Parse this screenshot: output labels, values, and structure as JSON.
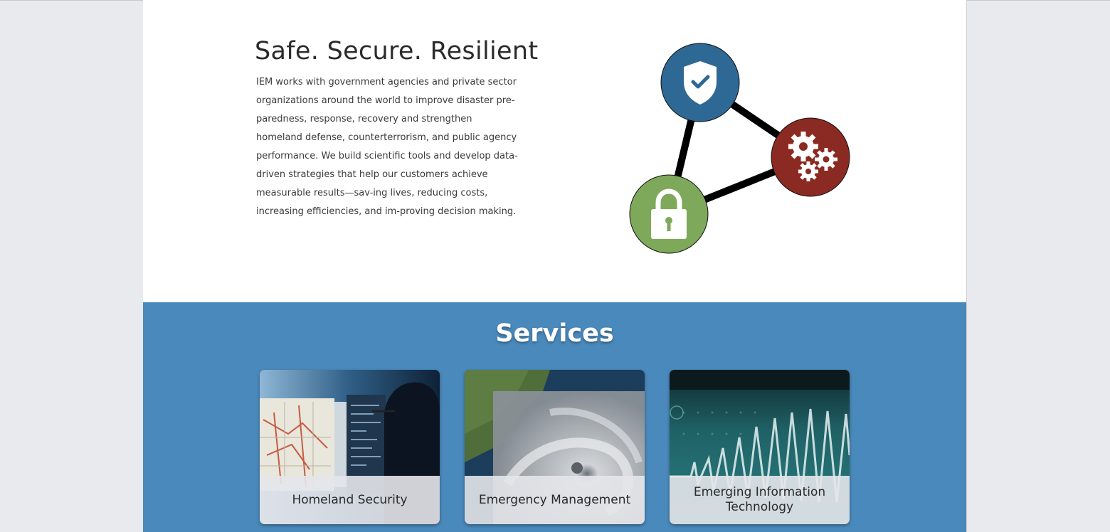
{
  "hero": {
    "title": "Safe. Secure. Resilient",
    "body": "IEM works with government agencies and private sector organizations around the world to improve disaster pre-paredness, response, recovery and strengthen homeland defense, counterterrorism, and public agency performance. We build scientific tools and develop data-driven strategies that help our customers achieve measurable results—sav-ing lives, reducing costs, increasing efficiencies, and im-proving decision making."
  },
  "graphic": {
    "nodes": [
      {
        "icon": "shield-check-icon",
        "color": "#2e6894"
      },
      {
        "icon": "gears-icon",
        "color": "#8b2a22"
      },
      {
        "icon": "padlock-icon",
        "color": "#7ea85a"
      }
    ]
  },
  "services": {
    "title": "Services",
    "background": "#4a89bb",
    "cards": [
      {
        "label": "Homeland Security"
      },
      {
        "label": "Emergency Management"
      },
      {
        "label": "Emerging Information Technology"
      }
    ]
  }
}
